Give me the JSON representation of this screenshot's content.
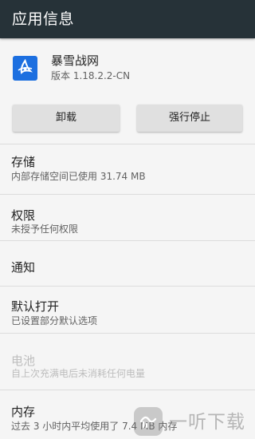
{
  "appbar": {
    "title": "应用信息"
  },
  "app": {
    "name": "暴雪战网",
    "version": "版本 1.18.2.2-CN",
    "icon": "battlenet-app-icon",
    "icon_color": "#1c6fe0"
  },
  "buttons": {
    "uninstall": "卸载",
    "force_stop": "强行停止"
  },
  "sections": {
    "storage": {
      "title": "存储",
      "sub": "内部存储空间已使用 31.74 MB"
    },
    "permissions": {
      "title": "权限",
      "sub": "未授予任何权限"
    },
    "notifications": {
      "title": "通知"
    },
    "open_by_default": {
      "title": "默认打开",
      "sub": "已设置部分默认选项"
    },
    "battery": {
      "title": "电池",
      "sub": "自上次充满电后未消耗任何电量",
      "enabled": false
    },
    "memory": {
      "title": "内存",
      "sub": "过去 3 小时内平均使用了 7.4 MB 内存"
    }
  },
  "watermark": {
    "text": "一听下载",
    "icon": "watermark-logo-icon"
  },
  "colors": {
    "appbar": "#263238",
    "background": "#f5f5f5",
    "button": "#e0e0e0"
  }
}
